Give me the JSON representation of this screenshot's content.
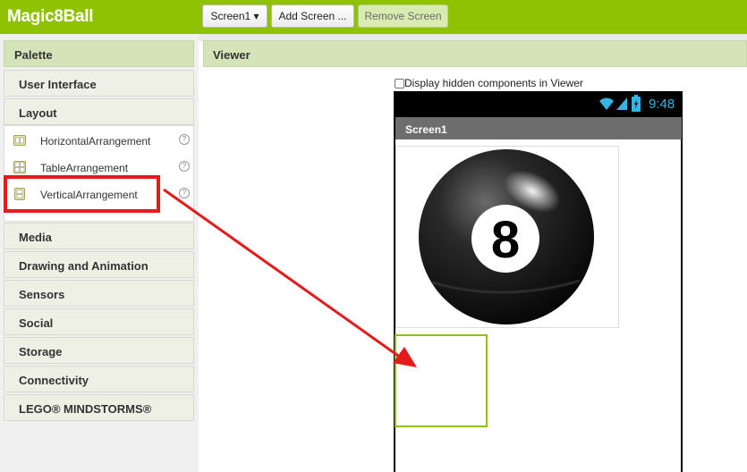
{
  "app": {
    "title": "Magic8Ball"
  },
  "toolbar": {
    "screen_select": "Screen1 ▾",
    "add_screen": "Add Screen ...",
    "remove_screen": "Remove Screen"
  },
  "palette": {
    "header": "Palette",
    "sections_top": [
      "User Interface",
      "Layout"
    ],
    "layout_items": [
      {
        "label": "HorizontalArrangement",
        "icon": "horizontal-arrangement-icon"
      },
      {
        "label": "TableArrangement",
        "icon": "table-arrangement-icon"
      },
      {
        "label": "VerticalArrangement",
        "icon": "vertical-arrangement-icon"
      }
    ],
    "help_glyph": "?",
    "sections_bottom": [
      "Media",
      "Drawing and Animation",
      "Sensors",
      "Social",
      "Storage",
      "Connectivity",
      "LEGO® MINDSTORMS®"
    ]
  },
  "annotation": {
    "step": "1",
    "color": "#e31b1b"
  },
  "viewer": {
    "header": "Viewer",
    "hidden_toggle_label": "Display hidden components in Viewer",
    "status_time": "9:48",
    "screen_title": "Screen1",
    "ball_number": "8"
  },
  "colors": {
    "brand_green": "#8fc202",
    "header_green": "#d5e3b8",
    "status_blue": "#33b5e5"
  }
}
